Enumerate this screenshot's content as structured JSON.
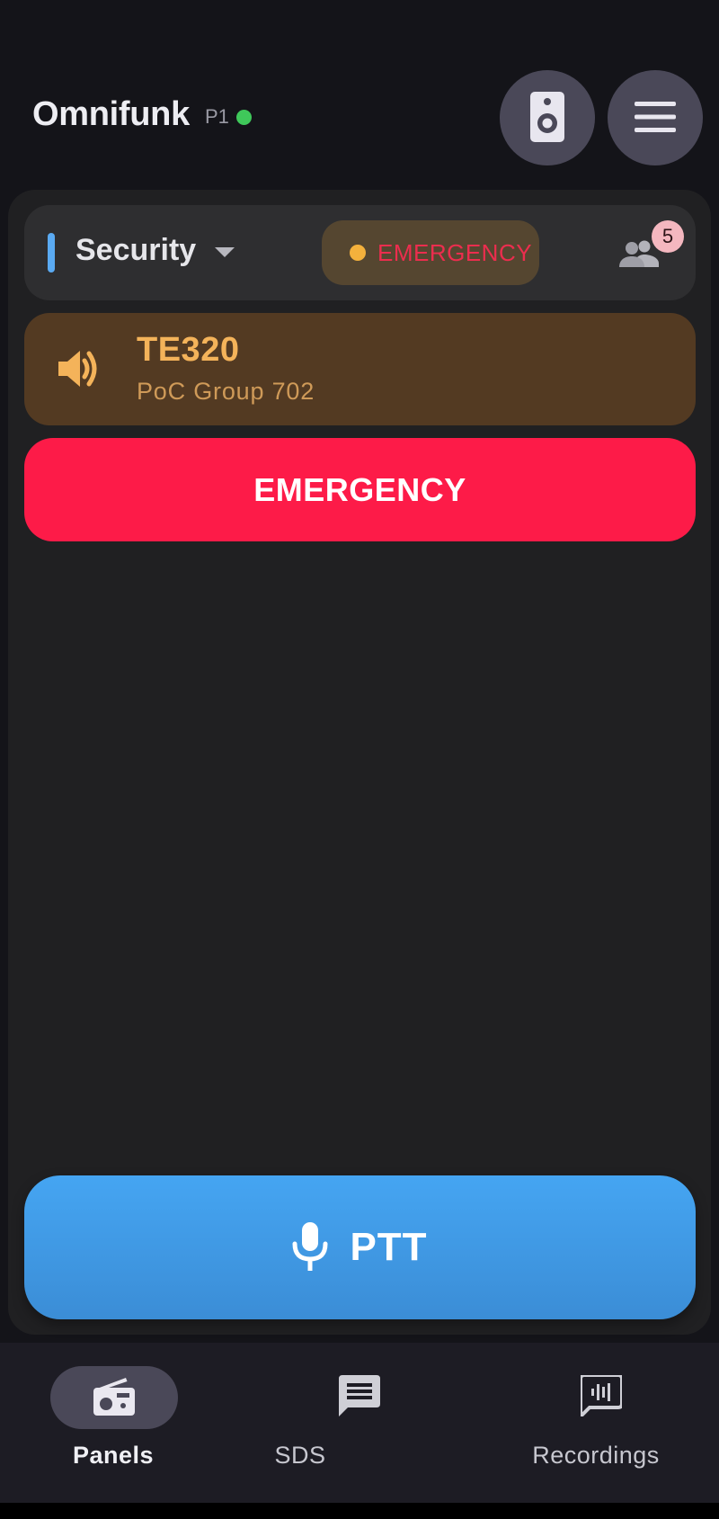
{
  "header": {
    "title": "Omnifunk",
    "profile": "P1",
    "connection_status_color": "#3fc85a",
    "speaker_icon": "speaker-icon",
    "menu_icon": "menu-icon"
  },
  "channel": {
    "name": "Security",
    "accent_color": "#5aaaf2",
    "emergency_chip_label": "EMERGENCY",
    "members_count": "5"
  },
  "active_call": {
    "title": "TE320",
    "subtitle": "PoC Group 702",
    "icon": "volume-up-icon"
  },
  "emergency_button": {
    "label": "EMERGENCY",
    "color": "#fd1b48"
  },
  "ptt_button": {
    "label": "PTT",
    "icon": "microphone-icon",
    "color": "#45a5f2"
  },
  "bottom_nav": {
    "items": [
      {
        "label": "Panels",
        "icon": "radio-icon",
        "active": true
      },
      {
        "label": "SDS",
        "icon": "message-icon",
        "active": false
      },
      {
        "label": "Recordings",
        "icon": "voice-message-icon",
        "active": false
      }
    ]
  }
}
